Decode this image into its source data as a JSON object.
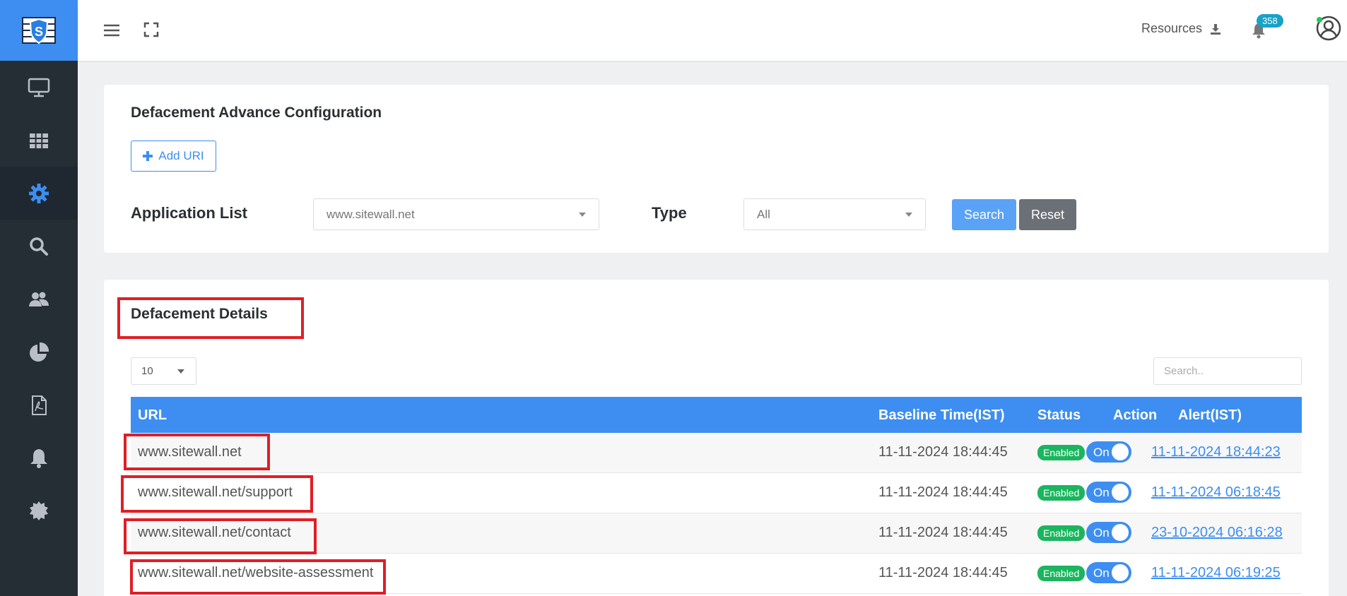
{
  "header": {
    "resources_label": "Resources",
    "notification_count": "358"
  },
  "sidebar": {
    "items": [
      {
        "icon": "monitor-icon"
      },
      {
        "icon": "grid-icon"
      },
      {
        "icon": "gear-icon",
        "active": true
      },
      {
        "icon": "search-icon"
      },
      {
        "icon": "users-icon"
      },
      {
        "icon": "pie-chart-icon"
      },
      {
        "icon": "pdf-icon"
      },
      {
        "icon": "bell-icon"
      },
      {
        "icon": "badge-icon"
      }
    ]
  },
  "config": {
    "title": "Defacement Advance Configuration",
    "add_uri_label": "Add URI",
    "app_list_label": "Application List",
    "app_list_value": "www.sitewall.net",
    "type_label": "Type",
    "type_value": "All",
    "search_label": "Search",
    "reset_label": "Reset"
  },
  "details": {
    "title": "Defacement Details",
    "page_size": "10",
    "search_placeholder": "Search..",
    "columns": {
      "url": "URL",
      "baseline": "Baseline Time(IST)",
      "status": "Status",
      "action": "Action",
      "alert": "Alert(IST)"
    },
    "rows": [
      {
        "url": "www.sitewall.net",
        "baseline": "11-11-2024 18:44:45",
        "status": "Enabled",
        "action": "On",
        "alert": "11-11-2024 18:44:23"
      },
      {
        "url": "www.sitewall.net/support",
        "baseline": "11-11-2024 18:44:45",
        "status": "Enabled",
        "action": "On",
        "alert": "11-11-2024 06:18:45"
      },
      {
        "url": "www.sitewall.net/contact",
        "baseline": "11-11-2024 18:44:45",
        "status": "Enabled",
        "action": "On",
        "alert": "23-10-2024 06:16:28"
      },
      {
        "url": "www.sitewall.net/website-assessment",
        "baseline": "11-11-2024 18:44:45",
        "status": "Enabled",
        "action": "On",
        "alert": "11-11-2024 06:19:25"
      }
    ]
  },
  "colors": {
    "accent": "#3d8ef0",
    "sidebar": "#252d35",
    "status_enabled": "#1ab55e",
    "highlight_box": "#e01e25"
  }
}
